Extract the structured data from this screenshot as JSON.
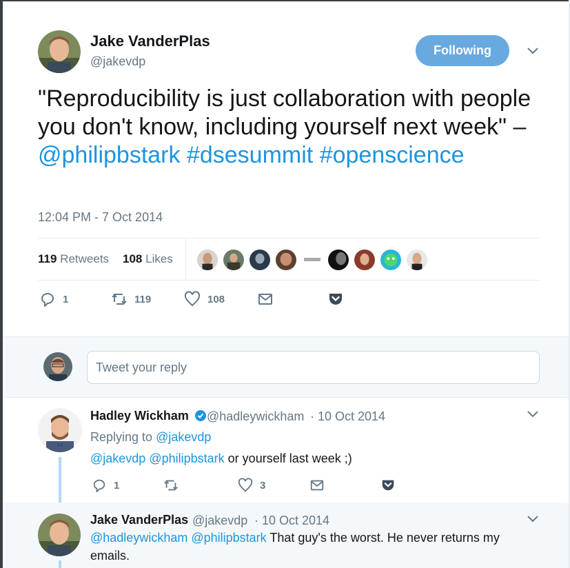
{
  "tweet": {
    "author_name": "Jake VanderPlas",
    "author_handle": "@jakevdp",
    "follow_label": "Following",
    "text_quote": "\"Reproducibility is just collaboration with people you don't know, including yourself next week\" – ",
    "mention": "@philipbstark",
    "hashtag1": "#dsesummit",
    "hashtag2": "#openscience",
    "timestamp": "12:04 PM - 7 Oct 2014",
    "retweets_count": "119",
    "retweets_label": "Retweets",
    "likes_count": "108",
    "likes_label": "Likes",
    "reply_count": "1",
    "retweet_action_count": "119",
    "like_action_count": "108"
  },
  "reply_box": {
    "placeholder": "Tweet your reply"
  },
  "reply1": {
    "author_name": "Hadley Wickham",
    "author_handle": "@hadleywickham",
    "date": "· 10 Oct 2014",
    "replying_to_label": "Replying to ",
    "replying_to_handle": "@jakevdp",
    "mention1": "@jakevdp",
    "mention2": "@philipbstark",
    "text": " or yourself last week ;)",
    "reply_count": "1",
    "like_count": "3"
  },
  "reply2": {
    "author_name": "Jake VanderPlas",
    "author_handle": "@jakevdp",
    "date": "· 10 Oct 2014",
    "mention1": "@hadleywickham",
    "mention2": "@philipbstark",
    "text": " That guy's the worst. He never returns my emails."
  },
  "colors": {
    "link": "#1b95e0",
    "follow_button": "#68a9e0",
    "muted": "#657786",
    "thread_line": "#b3d8f5"
  }
}
